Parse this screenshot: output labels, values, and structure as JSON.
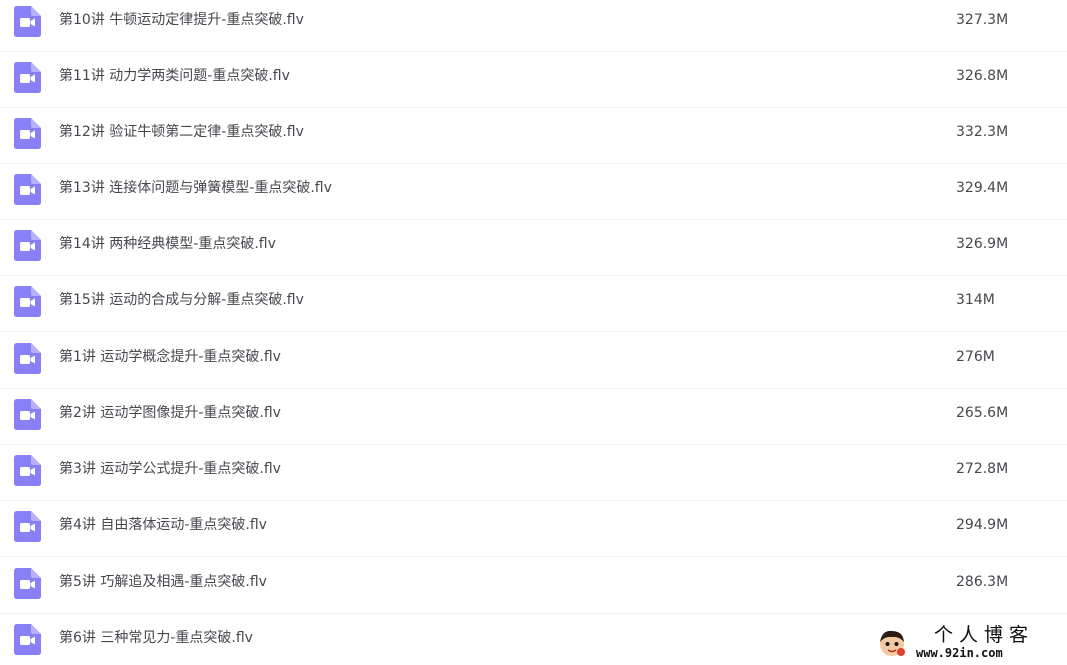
{
  "files": [
    {
      "name": "第10讲 牛顿运动定律提升-重点突破.flv",
      "size": "327.3M"
    },
    {
      "name": "第11讲 动力学两类问题-重点突破.flv",
      "size": "326.8M"
    },
    {
      "name": "第12讲 验证牛顿第二定律-重点突破.flv",
      "size": "332.3M"
    },
    {
      "name": "第13讲 连接体问题与弹簧模型-重点突破.flv",
      "size": "329.4M"
    },
    {
      "name": "第14讲 两种经典模型-重点突破.flv",
      "size": "326.9M"
    },
    {
      "name": "第15讲 运动的合成与分解-重点突破.flv",
      "size": "314M"
    },
    {
      "name": "第1讲 运动学概念提升-重点突破.flv",
      "size": "276M"
    },
    {
      "name": "第2讲 运动学图像提升-重点突破.flv",
      "size": "265.6M"
    },
    {
      "name": "第3讲 运动学公式提升-重点突破.flv",
      "size": "272.8M"
    },
    {
      "name": "第4讲 自由落体运动-重点突破.flv",
      "size": "294.9M"
    },
    {
      "name": "第5讲 巧解追及相遇-重点突破.flv",
      "size": "286.3M"
    },
    {
      "name": "第6讲 三种常见力-重点突破.flv",
      "size": "",
      "size_obscured": true
    }
  ],
  "icon": {
    "name": "video-file-icon",
    "color": "#8a80f6",
    "accent": "#ffffff"
  },
  "watermark": {
    "title": "个人博客",
    "url": "www.92in.com"
  }
}
